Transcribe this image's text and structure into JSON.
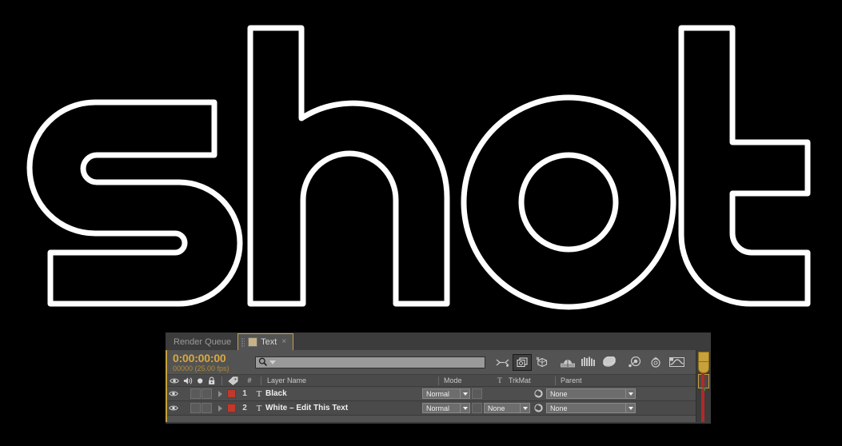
{
  "composition": {
    "background_color": "#000000",
    "text": "shot",
    "text_style": "outlined",
    "stroke_color": "#ffffff",
    "fill_color": "#000000"
  },
  "panel": {
    "accent_color": "#c8a13a",
    "background_color": "#535353",
    "tabs": [
      {
        "label": "Render Queue",
        "active": false,
        "closable": false,
        "icon": "none"
      },
      {
        "label": "Text",
        "active": true,
        "closable": true,
        "icon": "composition-icon",
        "close_glyph": "×"
      }
    ],
    "timecode": {
      "current": "0:00:00:00",
      "frames_and_fps": "00000 (25.00 fps)",
      "color": "#d8a83c"
    },
    "search": {
      "value": "",
      "placeholder": "",
      "icon": "search-icon"
    },
    "switch_icons": [
      {
        "name": "live-update-icon",
        "glyph": "live-update",
        "active": false
      },
      {
        "name": "draft-3d-icon",
        "glyph": "draft-3d",
        "active": true
      },
      {
        "name": "hide-shy-layers-icon",
        "glyph": "shy",
        "active": false
      },
      {
        "name": "enable-frame-blending-icon",
        "glyph": "frame-blend",
        "active": false
      },
      {
        "name": "enable-motion-blur-icon",
        "glyph": "motion-blur",
        "active": false
      },
      {
        "name": "brainstorm-icon",
        "glyph": "brainstorm",
        "active": false
      },
      {
        "name": "auto-keyframe-icon",
        "glyph": "auto-key",
        "active": false
      },
      {
        "name": "graph-editor-icon",
        "glyph": "graph-editor",
        "active": false
      }
    ],
    "columns": {
      "switch_icons": [
        "eye-icon",
        "audio-icon",
        "solo-icon",
        "lock-icon"
      ],
      "label_icon": "label-tag-icon",
      "number": "#",
      "layer_name": "Layer Name",
      "mode": "Mode",
      "track_matte_t": "T",
      "track_matte": "TrkMat",
      "parent": "Parent"
    },
    "layers": [
      {
        "index": "1",
        "type_glyph": "T",
        "name": "Black",
        "visible": true,
        "label_color": "#c0392b",
        "mode": "Normal",
        "has_trkmat_dropdown": false,
        "trkmat": "",
        "parent": "None"
      },
      {
        "index": "2",
        "type_glyph": "T",
        "name": "White – Edit This Text",
        "visible": true,
        "label_color": "#c0392b",
        "mode": "Normal",
        "has_trkmat_dropdown": true,
        "trkmat": "None",
        "parent": "None"
      }
    ]
  }
}
